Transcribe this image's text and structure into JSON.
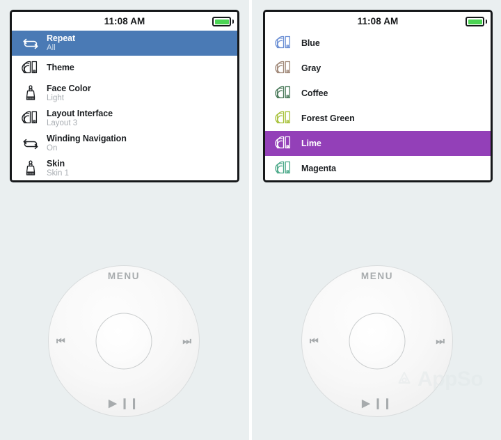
{
  "background_color": "#eaeff0",
  "accent_colors": {
    "settings_selected": "#4a7ab5",
    "theme_selected": "#9340b8",
    "battery_green": "#4cd454"
  },
  "left_panel": {
    "status_bar": {
      "time": "11:08 AM",
      "battery_icon": "battery-full-icon"
    },
    "settings": [
      {
        "icon": "repeat-icon",
        "icon_color": "#ffffff",
        "title": "Repeat",
        "subtitle": "All",
        "selected": true
      },
      {
        "icon": "color-swatch-icon",
        "icon_color": "#1c1f22",
        "title": "Theme",
        "subtitle": "",
        "selected": false
      },
      {
        "icon": "paintbrush-icon",
        "icon_color": "#1c1f22",
        "title": "Face Color",
        "subtitle": "Light",
        "selected": false
      },
      {
        "icon": "color-swatch-icon",
        "icon_color": "#1c1f22",
        "title": "Layout Interface",
        "subtitle": "Layout 3",
        "selected": false
      },
      {
        "icon": "repeat-icon",
        "icon_color": "#1c1f22",
        "title": "Winding Navigation",
        "subtitle": "On",
        "selected": false
      },
      {
        "icon": "paintbrush-icon",
        "icon_color": "#1c1f22",
        "title": "Skin",
        "subtitle": "Skin 1",
        "selected": false
      }
    ],
    "clickwheel": {
      "menu_label": "MENU",
      "prev_label": "⏮",
      "next_label": "⏭",
      "play_label": "▶ ❙❙"
    }
  },
  "right_panel": {
    "status_bar": {
      "time": "11:08 AM",
      "battery_icon": "battery-full-icon"
    },
    "themes": [
      {
        "label": "Blue",
        "swatch_color": "#6b8fd4",
        "selected": false
      },
      {
        "label": "Gray",
        "swatch_color": "#a08878",
        "selected": false
      },
      {
        "label": "Coffee",
        "swatch_color": "#4a7a5a",
        "selected": false
      },
      {
        "label": "Forest Green",
        "swatch_color": "#a8c23c",
        "selected": false
      },
      {
        "label": "Lime",
        "swatch_color": "#ffffff",
        "selected": true
      },
      {
        "label": "Magenta",
        "swatch_color": "#4aa888",
        "selected": false
      }
    ],
    "clickwheel": {
      "menu_label": "MENU",
      "prev_label": "⏮",
      "next_label": "⏭",
      "play_label": "▶ ❙❙"
    },
    "watermark": {
      "text": "AppSo",
      "logo_icon": "appso-logo-icon"
    }
  }
}
